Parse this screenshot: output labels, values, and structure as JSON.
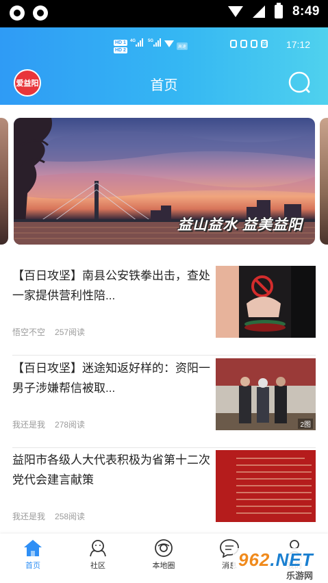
{
  "status_bar": {
    "time": "8:49",
    "icons": [
      "sync-icon",
      "sync-icon",
      "wifi-icon",
      "cell-signal-icon",
      "battery-icon"
    ]
  },
  "inner_status": {
    "sim1": "HD 1",
    "sim2": "HD 2",
    "net1": "4G",
    "net2": "5G",
    "wifi_badge": "高速",
    "battery": "55",
    "time": "17:12"
  },
  "header": {
    "logo_text": "爱益阳",
    "title": "首页",
    "search_icon": "search-icon"
  },
  "banner": {
    "caption": "益山益水  益美益阳"
  },
  "news": [
    {
      "title": "【百日攻坚】南县公安铁拳出击，查处一家提供营利性陪...",
      "author": "悟空不空",
      "reads": "257阅读",
      "image_count": ""
    },
    {
      "title": "【百日攻坚】迷途知返好样的：资阳一男子涉嫌帮信被取...",
      "author": "我还是我",
      "reads": "278阅读",
      "image_count": "2图"
    },
    {
      "title": "益阳市各级人大代表积极为省第十二次党代会建言献策",
      "author": "我还是我",
      "reads": "258阅读",
      "image_count": ""
    }
  ],
  "bottom_nav": [
    {
      "label": "首页",
      "icon": "home-icon",
      "active": true
    },
    {
      "label": "社区",
      "icon": "community-icon",
      "active": false
    },
    {
      "label": "本地圈",
      "icon": "local-circle-icon",
      "active": false
    },
    {
      "label": "消息",
      "icon": "message-icon",
      "active": false
    },
    {
      "label": "我的",
      "icon": "profile-icon",
      "active": false
    }
  ],
  "watermark": {
    "main": "962.NET",
    "main_prefix": "962",
    "main_suffix": ".NET",
    "sub": "乐游网"
  },
  "colors": {
    "header_gradient_start": "#2f9bf5",
    "header_gradient_end": "#4fd1ee",
    "active_tab": "#2f8ff5",
    "logo_red": "#e8353a",
    "meta_text": "#9a9a9a"
  }
}
